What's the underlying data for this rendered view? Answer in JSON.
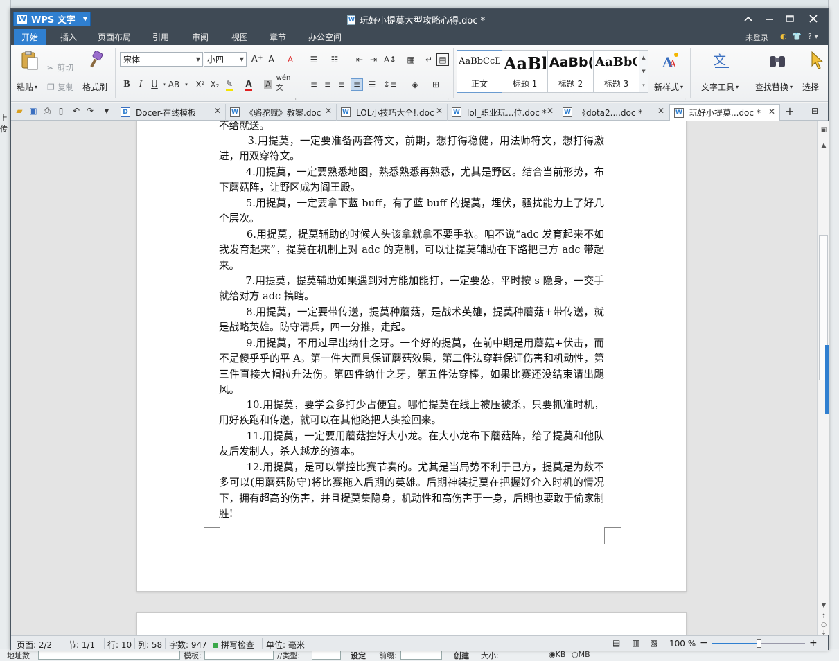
{
  "app": {
    "name": "WPS 文字",
    "doc_title": "玩好小提莫大型攻略心得.doc *"
  },
  "menu": {
    "tabs": [
      "开始",
      "插入",
      "页面布局",
      "引用",
      "审阅",
      "视图",
      "章节",
      "办公空间"
    ],
    "active": "开始",
    "login": "未登录",
    "help": "?"
  },
  "ribbon": {
    "paste": "粘贴",
    "cut": "剪切",
    "copy": "复制",
    "format_painter": "格式刷",
    "font_name": "宋体",
    "font_size": "小四",
    "bold": "B",
    "italic": "I",
    "underline": "U",
    "strike": "AB",
    "superscript": "X²",
    "subscript": "X₂",
    "styles": [
      {
        "sample": "AaBbCcDd",
        "name": "正文"
      },
      {
        "sample": "AaBl",
        "name": "标题 1"
      },
      {
        "sample": "AaBb(",
        "name": "标题 2"
      },
      {
        "sample": "AaBbC",
        "name": "标题 3"
      }
    ],
    "new_style": "新样式",
    "text_tools": "文字工具",
    "find_replace": "查找替换",
    "select": "选择"
  },
  "doc_tabs": [
    {
      "label": "Docer-在线模板",
      "active": false
    },
    {
      "label": "《骆驼赋》教案.doc",
      "active": false
    },
    {
      "label": "LOL小技巧大全!.doc",
      "active": false
    },
    {
      "label": "lol_职业玩...位.doc *",
      "active": false
    },
    {
      "label": "《dota2....doc *",
      "active": false
    },
    {
      "label": "玩好小提莫...doc *",
      "active": true
    }
  ],
  "document": {
    "paragraphs": [
      "不给就送。",
      "        3.用提莫，一定要准备两套符文，前期，想打得稳健，用法师符文，想打得激进，用双穿符文。",
      "        4.用提莫，一定要熟悉地图，熟悉熟悉再熟悉，尤其是野区。结合当前形势，布下蘑菇阵，让野区成为阎王殿。",
      "        5.用提莫，一定要拿下蓝 buff，有了蓝 buff 的提莫，埋伏，骚扰能力上了好几个层次。",
      "        6.用提莫，提莫辅助的时候人头该拿就拿不要手软。咱不说“adc 发育起来不如我发育起来”，提莫在机制上对 adc 的克制，可以让提莫辅助在下路把己方 adc 带起来。",
      "        7.用提莫，提莫辅助如果遇到对方能加能打，一定要怂，平时按 s 隐身，一交手就给对方 adc 搞瞎。",
      "        8.用提莫，一定要带传送，提莫种蘑菇，是战术英雄，提莫种蘑菇+带传送，就是战略英雄。防守清兵，四一分推，走起。",
      "        9.用提莫，不用过早出纳什之牙。一个好的提莫，在前中期是用蘑菇+伏击，而不是傻乎乎的平 A。第一件大面具保证蘑菇效果，第二件法穿鞋保证伤害和机动性，第三件直接大帽拉升法伤。第四件纳什之牙，第五件法穿棒，如果比赛还没结束请出飓风。",
      "        10.用提莫，要学会多打少占便宜。哪怕提莫在线上被压被杀，只要抓准时机，用好疾跑和传送，就可以在其他路把人头捡回来。",
      "        11.用提莫，一定要用蘑菇控好大小龙。在大小龙布下蘑菇阵，给了提莫和他队友后发制人，杀人越龙的资本。",
      "        12.用提莫，是可以掌控比赛节奏的。尤其是当局势不利于己方，提莫是为数不多可以(用蘑菇防守)将比赛拖入后期的英雄。后期神装提莫在把握好介入时机的情况下，拥有超高的伤害，并且提莫集隐身，机动性和高伤害于一身，后期也要敢于偷家制胜!"
    ]
  },
  "status": {
    "page": "页面: 2/2",
    "section": "节: 1/1",
    "row": "行: 10",
    "col": "列: 58",
    "wordcount": "字数: 947",
    "spellcheck": "拼写检查",
    "unit": "单位: 毫米",
    "zoom": "100 %",
    "zoom_level": 0.5
  },
  "background": {
    "bottom_left": "地址数",
    "bottom_mid1": "模板:",
    "bottom_mid2": "//类型:",
    "bottom_btn1": "设定",
    "bottom_mid3": "前缀:",
    "bottom_btn2": "创建",
    "bottom_mid4": "大小:",
    "bottom_radio1": "KB",
    "bottom_radio2": "MB",
    "left_text": "上传"
  },
  "colors": {
    "accent": "#2f7fd0",
    "titlebar": "#3f4a55"
  }
}
